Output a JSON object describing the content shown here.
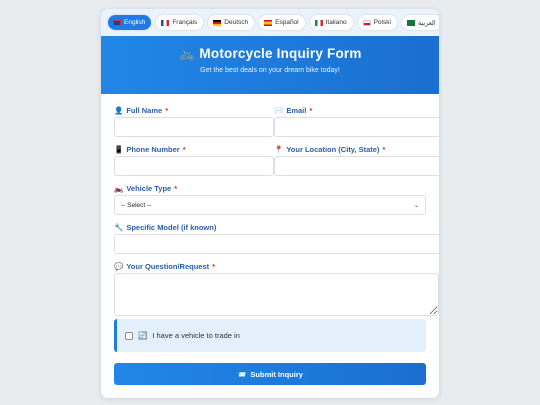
{
  "languages": [
    {
      "label": "English",
      "flag": "gb-flag",
      "active": true
    },
    {
      "label": "Français",
      "flag": "fr-flag"
    },
    {
      "label": "Deutsch",
      "flag": "de-flag"
    },
    {
      "label": "Español",
      "flag": "es-flag"
    },
    {
      "label": "Italiano",
      "flag": "it-flag"
    },
    {
      "label": "Polski",
      "flag": "pl-flag"
    },
    {
      "label": "العربية",
      "flag": "sa-flag"
    }
  ],
  "header": {
    "icon": "🚲",
    "title": "Motorcycle Inquiry Form",
    "subtitle": "Get the best deals on your dream bike today!"
  },
  "form": {
    "full_name": {
      "icon": "👤",
      "label": "Full Name",
      "required": "*",
      "value": ""
    },
    "email": {
      "icon": "✉️",
      "label": "Email",
      "required": "*",
      "value": ""
    },
    "phone": {
      "icon": "📱",
      "label": "Phone Number",
      "required": "*",
      "value": ""
    },
    "location": {
      "icon": "📍",
      "label": "Your Location (City, State)",
      "required": "*",
      "value": ""
    },
    "vehicle_type": {
      "icon": "🏍️",
      "label": "Vehicle Type",
      "required": "*",
      "selected": "-- Select --"
    },
    "model": {
      "icon": "🔧",
      "label": "Specific Model (if known)",
      "value": ""
    },
    "question": {
      "icon": "💬",
      "label": "Your Question/Request",
      "required": "*",
      "value": ""
    },
    "trade_in": {
      "icon": "🔄",
      "label": "I have a vehicle to trade in",
      "checked": false
    }
  },
  "submit": {
    "icon": "📨",
    "label": "Submit Inquiry"
  },
  "colors": {
    "accent": "#1e7be6",
    "label": "#2a5fa3",
    "required": "#d63333"
  }
}
